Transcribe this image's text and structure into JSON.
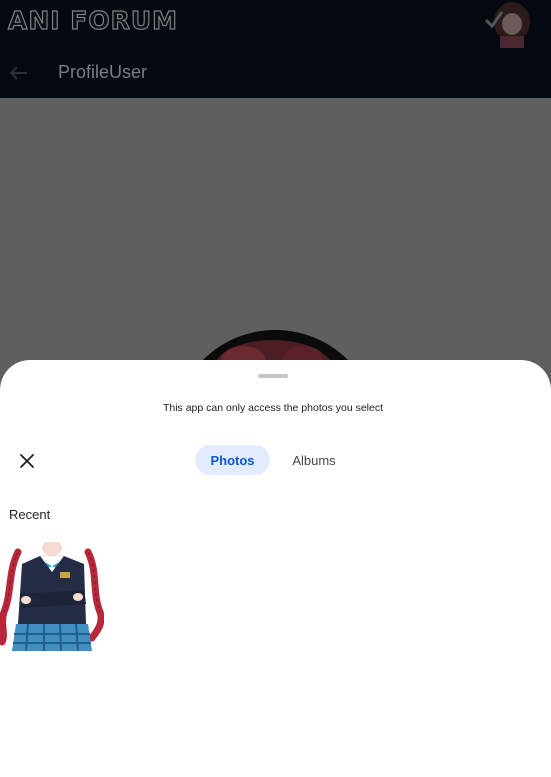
{
  "app": {
    "logo_text": "ANI FORUM",
    "page_title": "ProfileUser"
  },
  "picker": {
    "notice": "This app can only access the photos you select",
    "tabs": [
      {
        "label": "Photos",
        "selected": true
      },
      {
        "label": "Albums",
        "selected": false
      }
    ],
    "section_label": "Recent",
    "photos": [
      {
        "icon": "anime-character-thumbnail"
      }
    ]
  },
  "colors": {
    "header_bg": "#03090f",
    "scrim": "#5f5f5f",
    "tab_selected_bg": "#e3ecfd",
    "tab_selected_text": "#0b57d0"
  }
}
